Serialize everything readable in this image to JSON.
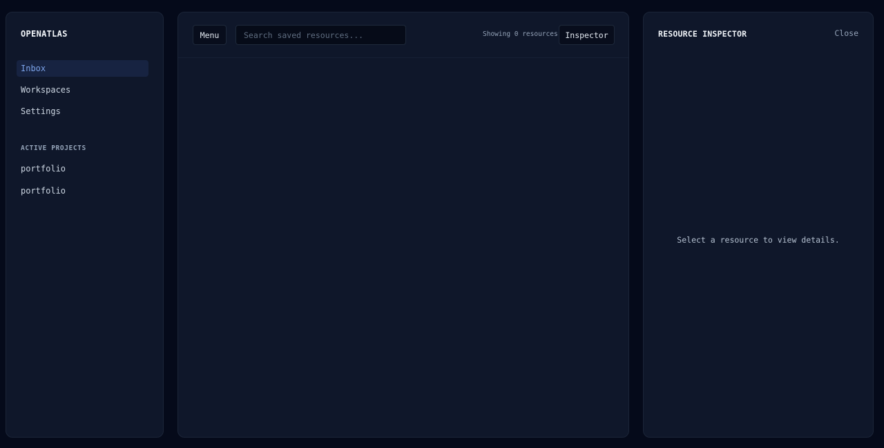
{
  "sidebar": {
    "brand": "OPENATLAS",
    "nav": [
      {
        "label": "Inbox",
        "active": true
      },
      {
        "label": "Workspaces",
        "active": false
      },
      {
        "label": "Settings",
        "active": false
      }
    ],
    "projects_title": "ACTIVE PROJECTS",
    "projects": [
      {
        "label": "portfolio"
      },
      {
        "label": "portfolio"
      }
    ]
  },
  "toolbar": {
    "menu_label": "Menu",
    "search_value": "",
    "search_placeholder": "Search saved resources...",
    "count_text": "Showing 0 resources",
    "inspector_label": "Inspector"
  },
  "inspector": {
    "title": "RESOURCE INSPECTOR",
    "close_label": "Close",
    "empty_message": "Select a resource to view details."
  },
  "colors": {
    "background": "#050a1a",
    "panel": "#0f172a",
    "accent": "#7ba2e8",
    "active_item_bg": "#172341"
  }
}
